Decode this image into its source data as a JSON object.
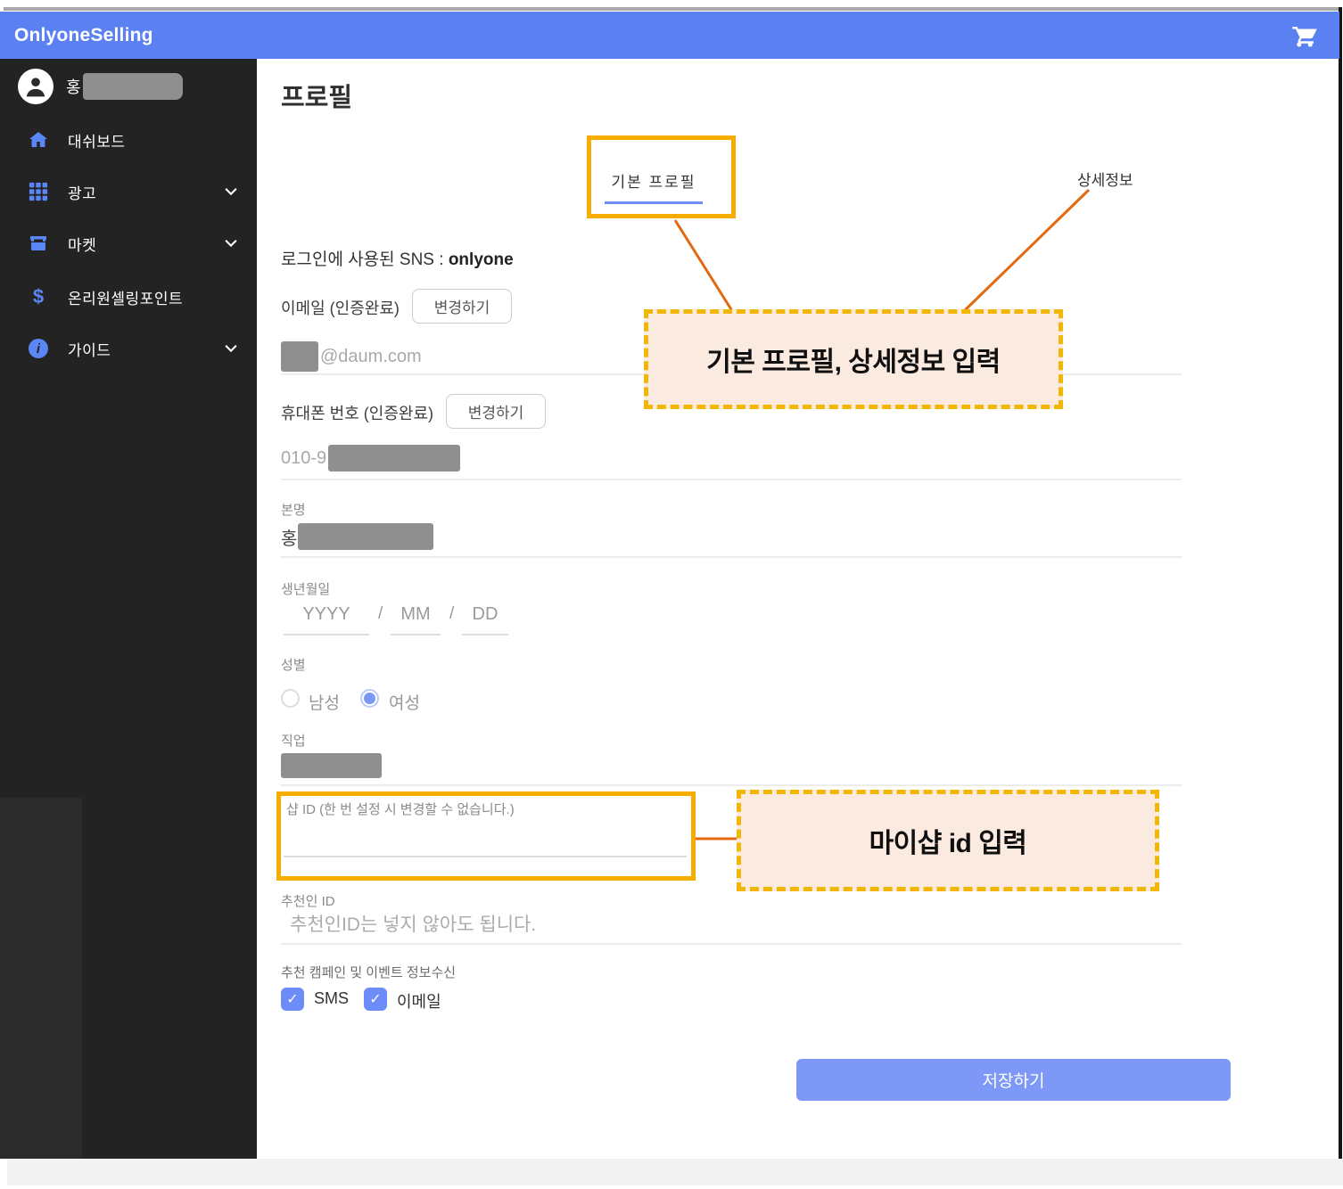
{
  "header": {
    "logo": "OnlyoneSelling"
  },
  "sidebar": {
    "user_name_prefix": "홍",
    "items": [
      {
        "label": "대쉬보드"
      },
      {
        "label": "광고"
      },
      {
        "label": "마켓"
      },
      {
        "label": "온리원셀링포인트"
      },
      {
        "label": "가이드"
      }
    ],
    "dollar_glyph": "$",
    "info_glyph": "i"
  },
  "main": {
    "page_title": "프로필",
    "tab_label": "기본 프로필",
    "sns_prefix": "로그인에 사용된 SNS : ",
    "sns_value": "onlyone",
    "email_label": "이메일 (인증완료)",
    "email_change_button": "변경하기",
    "email_value_suffix": "@daum.com",
    "phone_label": "휴대폰 번호 (인증완료)",
    "phone_change_button": "변경하기",
    "phone_value_prefix": "010-9",
    "realname_label": "본명",
    "realname_value_prefix": "홍",
    "birth_label": "생년월일",
    "birth_yyyy": "YYYY",
    "birth_slash1": "/",
    "birth_mm": "MM",
    "birth_slash2": "/",
    "birth_dd": "DD",
    "gender_label": "성별",
    "gender_male": "남성",
    "gender_female": "여성",
    "job_label": "직업",
    "shop_id_placeholder": "샵 ID (한 번 설정 시 변경할 수 없습니다.)",
    "referrer_label": "추천인 ID",
    "referrer_placeholder": "추천인ID는 넣지 않아도 됩니다.",
    "marketing_label": "추천 캠페인 및 이벤트 정보수신",
    "sms_label": "SMS",
    "email_opt_label": "이메일",
    "checkmark": "✓",
    "save_button": "저장하기"
  },
  "annotations": {
    "detail_tab_label": "상세정보",
    "note1": "기본 프로필, 상세정보 입력",
    "note2": "마이샵 id 입력"
  },
  "colors": {
    "header_blue": "#5b80f2",
    "sidebar_bg": "#232323",
    "icon_blue": "#5a87f5",
    "tab_underline": "#6e8ef5",
    "annotation_gold": "#f5ad00",
    "annotation_dashed_gold": "#f2b705",
    "annotation_fill": "#fbeadf",
    "connector_orange": "#e2690f",
    "save_button_blue": "#7e98f8",
    "checkbox_blue": "#6c8cf8",
    "redaction_gray": "#8f8f8f"
  }
}
